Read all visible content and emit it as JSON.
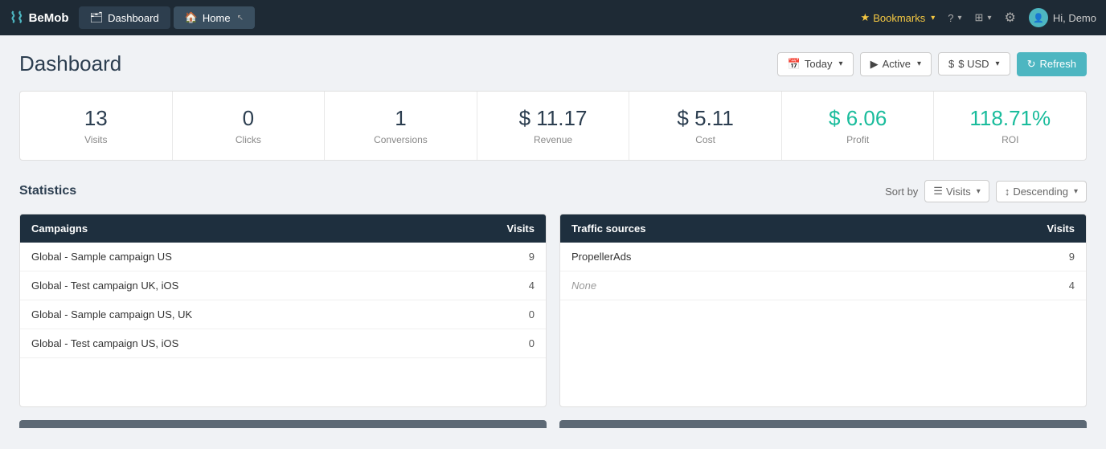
{
  "navbar": {
    "brand": "BeMob",
    "tabs": [
      {
        "label": "Dashboard",
        "icon": "🗂",
        "active": false
      },
      {
        "label": "Home",
        "icon": "🏠",
        "active": true
      }
    ],
    "bookmarks_label": "Bookmarks",
    "help_label": "?",
    "active_label": "Active",
    "refresh_label": "Refresh",
    "user_label": "Hi, Demo"
  },
  "page": {
    "title": "Dashboard"
  },
  "toolbar": {
    "date_label": "Today",
    "active_label": "Active",
    "currency_label": "$ USD",
    "refresh_label": "Refresh"
  },
  "stats": [
    {
      "value": "13",
      "label": "Visits",
      "positive": false
    },
    {
      "value": "0",
      "label": "Clicks",
      "positive": false
    },
    {
      "value": "1",
      "label": "Conversions",
      "positive": false
    },
    {
      "value": "$ 11.17",
      "label": "Revenue",
      "positive": false
    },
    {
      "value": "$ 5.11",
      "label": "Cost",
      "positive": false
    },
    {
      "value": "$ 6.06",
      "label": "Profit",
      "positive": true
    },
    {
      "value": "118.71%",
      "label": "ROI",
      "positive": true
    }
  ],
  "statistics": {
    "title": "Statistics",
    "sort_by_label": "Sort by",
    "sort_field": "Visits",
    "sort_order": "Descending"
  },
  "campaigns_table": {
    "title": "Campaigns",
    "visits_label": "Visits",
    "rows": [
      {
        "name": "Global - Sample campaign US",
        "value": "9"
      },
      {
        "name": "Global - Test campaign UK, iOS",
        "value": "4"
      },
      {
        "name": "Global - Sample campaign US, UK",
        "value": "0"
      },
      {
        "name": "Global - Test campaign US, iOS",
        "value": "0"
      }
    ]
  },
  "traffic_table": {
    "title": "Traffic sources",
    "visits_label": "Visits",
    "rows": [
      {
        "name": "PropellerAds",
        "value": "9"
      },
      {
        "name": "None",
        "value": "4",
        "italic": true
      }
    ]
  }
}
